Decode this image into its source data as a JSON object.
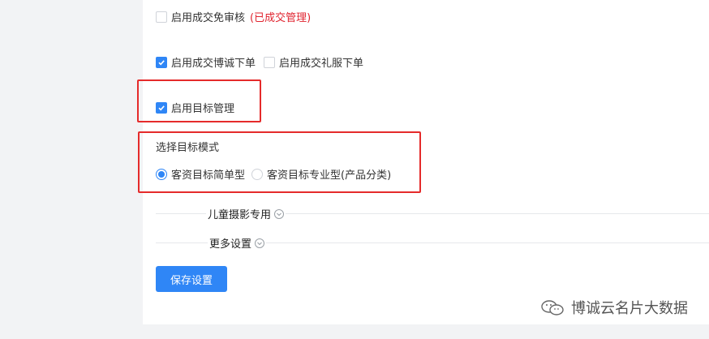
{
  "options": {
    "deal_free_review": {
      "label": "启用成交免审核",
      "note": "(已成交管理)",
      "checked": false
    },
    "deal_bocheng_order": {
      "label": "启用成交博诚下单",
      "checked": true
    },
    "deal_dress_order": {
      "label": "启用成交礼服下单",
      "checked": false
    },
    "target_management": {
      "label": "启用目标管理",
      "checked": true
    }
  },
  "target_mode": {
    "title": "选择目标模式",
    "options": [
      {
        "label": "客资目标简单型",
        "selected": true
      },
      {
        "label": "客资目标专业型(产品分类)",
        "selected": false
      }
    ]
  },
  "sections": {
    "kids_photo": "儿童摄影专用",
    "more_settings": "更多设置"
  },
  "save_button": "保存设置",
  "watermark": "博诚云名片大数据",
  "colors": {
    "accent": "#2f86f6",
    "highlight": "#e52b2b",
    "note": "#e0242f"
  }
}
